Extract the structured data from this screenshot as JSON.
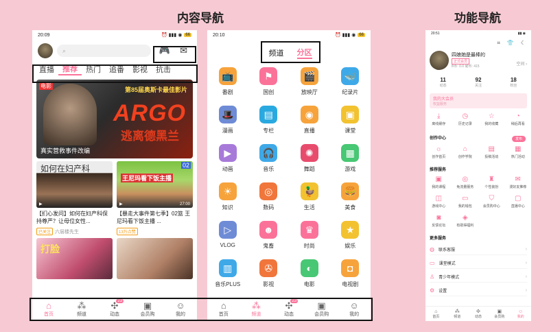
{
  "sections": {
    "content_nav": "内容导航",
    "function_nav": "功能导航"
  },
  "phone1": {
    "time": "20:09",
    "battery": "66",
    "search_placeholder": "",
    "icons": [
      "gamepad-icon",
      "mail-icon"
    ],
    "tabs": [
      "直播",
      "推荐",
      "热门",
      "追番",
      "影视",
      "抗击"
    ],
    "banner": {
      "award": "第85届奥斯卡最佳影片",
      "title": "ARGO",
      "subtitle": "逃离德黑兰",
      "caption": "真实营救事件改编",
      "corner": "电影"
    },
    "cards": [
      {
        "thumb_text": "如何在妇产科",
        "title": "【扪心发问】如何在妇产科保持尊严？让母位女性...",
        "tag": "已关注",
        "author": "六层楼先生"
      },
      {
        "thumb_text": "王尼玛看下饭主播",
        "num": "02",
        "title": "【暴走大事件第七季】02篮 王尼玛看下饭主播 ...",
        "tag": "",
        "author": "13万点赞",
        "dur": "27:00"
      }
    ],
    "row2": [
      {
        "thumb_text": "打脸"
      },
      {
        "thumb_text": ""
      }
    ],
    "tabbar": [
      "首页",
      "频道",
      "动态",
      "会员购",
      "我的"
    ],
    "badge": "23"
  },
  "phone2": {
    "time": "20:10",
    "seg": [
      "频道",
      "分区"
    ],
    "grid": [
      {
        "label": "番剧",
        "icon": "tv-icon",
        "color": "#f6a33c"
      },
      {
        "label": "国创",
        "icon": "flag-icon",
        "color": "#fb7299"
      },
      {
        "label": "放映厅",
        "icon": "theater-icon",
        "color": "#f6a33c"
      },
      {
        "label": "纪录片",
        "icon": "whale-icon",
        "color": "#3fa9e8"
      },
      {
        "label": "漫画",
        "icon": "hat-icon",
        "color": "#6e8bd6"
      },
      {
        "label": "专栏",
        "icon": "column-icon",
        "color": "#2aa9e0"
      },
      {
        "label": "直播",
        "icon": "live-icon",
        "color": "#f6a33c"
      },
      {
        "label": "课堂",
        "icon": "class-icon",
        "color": "#f2c230"
      },
      {
        "label": "动画",
        "icon": "play-icon",
        "color": "#a77ad9"
      },
      {
        "label": "音乐",
        "icon": "headphone-icon",
        "color": "#3fa9e8"
      },
      {
        "label": "舞蹈",
        "icon": "fan-icon",
        "color": "#e84c6d"
      },
      {
        "label": "游戏",
        "icon": "creeper-icon",
        "color": "#48c774"
      },
      {
        "label": "知识",
        "icon": "bulb-icon",
        "color": "#f6a33c"
      },
      {
        "label": "数码",
        "icon": "camera-icon",
        "color": "#f0763c"
      },
      {
        "label": "生活",
        "icon": "duck-icon",
        "color": "#f2c230"
      },
      {
        "label": "美食",
        "icon": "food-icon",
        "color": "#f6a33c"
      },
      {
        "label": "VLOG",
        "icon": "vlog-icon",
        "color": "#6e8bd6"
      },
      {
        "label": "鬼畜",
        "icon": "ghost-icon",
        "color": "#fb7299"
      },
      {
        "label": "时尚",
        "icon": "dress-icon",
        "color": "#fb7299"
      },
      {
        "label": "娱乐",
        "icon": "star-icon",
        "color": "#f2c230"
      },
      {
        "label": "音乐PLUS",
        "icon": "film-icon",
        "color": "#3fa9e8"
      },
      {
        "label": "影视",
        "icon": "reel-icon",
        "color": "#f0763c"
      },
      {
        "label": "电影",
        "icon": "glasses-icon",
        "color": "#48c774"
      },
      {
        "label": "电视剧",
        "icon": "tvshow-icon",
        "color": "#f6a33c"
      }
    ],
    "tabbar": [
      "首页",
      "频道",
      "动态",
      "会员购",
      "我的"
    ],
    "badge": "23"
  },
  "phone3": {
    "time": "20:51",
    "username": "四娘她是最棒的",
    "vip": "正式会员",
    "coins": "B币: 0.0  硬币: 415",
    "space": "空间",
    "stats": [
      {
        "n": "11",
        "l": "动态"
      },
      {
        "n": "92",
        "l": "关注"
      },
      {
        "n": "18",
        "l": "粉丝"
      }
    ],
    "vipbar": {
      "title": "我的大会员",
      "sub": "权益服务"
    },
    "row1": [
      "离线缓存",
      "历史记录",
      "我的收藏",
      "稍后再看"
    ],
    "creator_title": "创作中心",
    "publish": "发布",
    "row2": [
      "创作首页",
      "创作学院",
      "投稿活动",
      "热门活动"
    ],
    "rec_title": "推荐服务",
    "row3": [
      "我的课程",
      "免流量服务",
      "个性装扮",
      "漫好友推荐"
    ],
    "row4": [
      "游戏中心",
      "我的钱包",
      "会员购中心",
      "直播中心"
    ],
    "row5": [
      "反馈论坛",
      "有助得福利"
    ],
    "more_title": "更多服务",
    "list": [
      "联系客服",
      "课堂模式",
      "青少年模式",
      "设置"
    ],
    "tabbar": [
      "首页",
      "频道",
      "动态",
      "会员购",
      "我的"
    ]
  }
}
